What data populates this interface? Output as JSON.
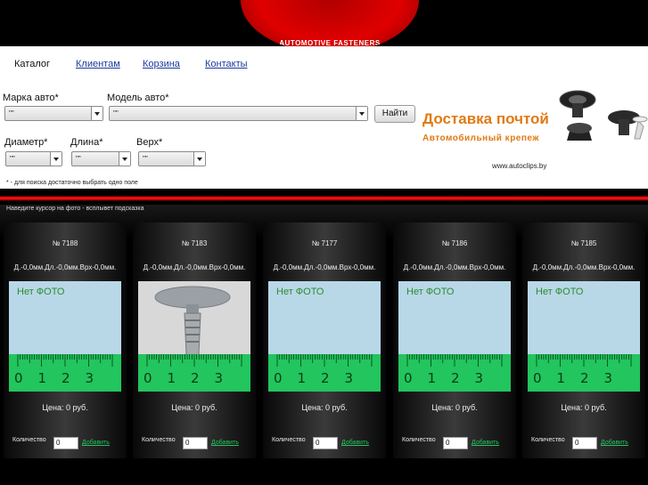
{
  "header": {
    "logo_text": "AUTOMOTIVE FASTENERS",
    "nav": [
      "Каталог",
      "Клиентам",
      "Корзина",
      "Контакты"
    ]
  },
  "search": {
    "brand_label": "Марка авто*",
    "brand_value": "\"\"",
    "model_label": "Модель авто*",
    "model_value": "\"\"",
    "find_button": "Найти",
    "diameter_label": "Диаметр*",
    "diameter_value": "\"\"",
    "length_label": "Длина*",
    "length_value": "\"\"",
    "top_label": "Верх*",
    "top_value": "\"\"",
    "hint": "* - для поиска достаточно выбрать одно поле"
  },
  "promo": {
    "title": "Доставка почтой",
    "subtitle": "Автомобильный крепеж",
    "url": "www.autoclips.by"
  },
  "products_hint": "Наведите курсор на фото - всплывет подсказка",
  "products": [
    {
      "number": "№ 7188",
      "dims": "Д.-0,0мм.Дл.-0,0мм.Врх-0,0мм.",
      "photo_label": "Нет ФОТО",
      "price": "Цена: 0 руб.",
      "qty_label": "Количество",
      "qty": "0",
      "add": "Добавить"
    },
    {
      "number": "№ 7183",
      "dims": "Д.-0,0мм.Дл.-0,0мм.Врх-0,0мм.",
      "photo_label": "",
      "price": "Цена: 0 руб.",
      "qty_label": "Количество",
      "qty": "0",
      "add": "Добавить"
    },
    {
      "number": "№ 7177",
      "dims": "Д.-0,0мм.Дл.-0,0мм.Врх-0,0мм.",
      "photo_label": "Нет ФОТО",
      "price": "Цена: 0 руб.",
      "qty_label": "Количество",
      "qty": "0",
      "add": "Добавить"
    },
    {
      "number": "№ 7186",
      "dims": "Д.-0,0мм.Дл.-0,0мм.Врх-0,0мм.",
      "photo_label": "Нет ФОТО",
      "price": "Цена: 0 руб.",
      "qty_label": "Количество",
      "qty": "0",
      "add": "Добавить"
    },
    {
      "number": "№ 7185",
      "dims": "Д.-0,0мм.Дл.-0,0мм.Врх-0,0мм.",
      "photo_label": "Нет ФОТО",
      "price": "Цена: 0 руб.",
      "qty_label": "Количество",
      "qty": "0",
      "add": "Добавить"
    }
  ],
  "ruler_numbers": [
    "0",
    "1",
    "2",
    "3"
  ],
  "colors": {
    "accent_red": "#e00000",
    "promo_orange": "#e07a12",
    "link_green": "#22c55e",
    "nav_blue": "#1a3a9c"
  }
}
